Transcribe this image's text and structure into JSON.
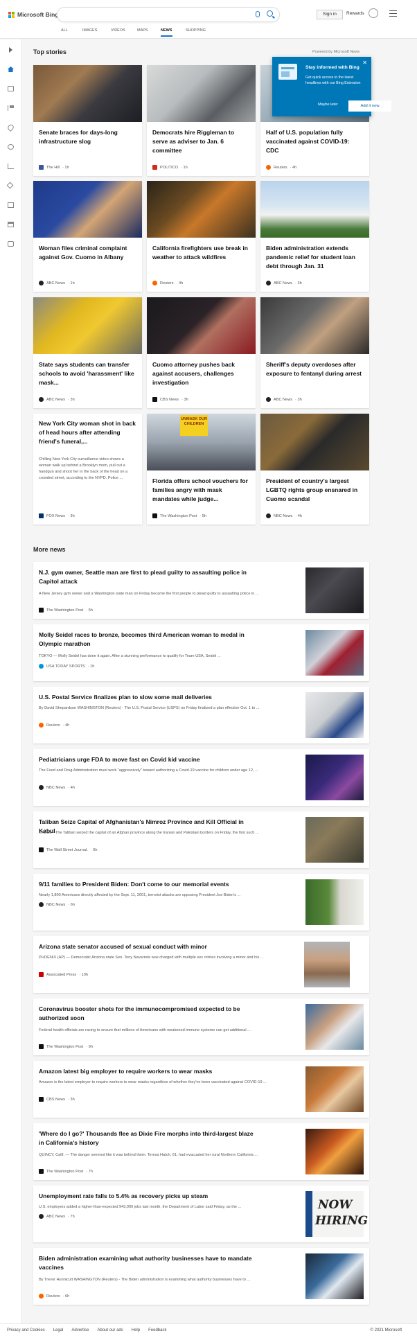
{
  "header": {
    "logo_text": "Microsoft Bing",
    "signin_label": "Sign in",
    "rewards_label": "Rewards",
    "tabs": [
      {
        "label": "ALL"
      },
      {
        "label": "IMAGES"
      },
      {
        "label": "VIDEOS"
      },
      {
        "label": "MAPS"
      },
      {
        "label": "NEWS"
      },
      {
        "label": "SHOPPING"
      }
    ]
  },
  "top_stories": {
    "title": "Top stories",
    "powered_by": "Powered by Microsoft News",
    "cards": [
      {
        "title": "Senate braces for days-long infrastructure slog",
        "source": "The Hill",
        "time": "· 1h"
      },
      {
        "title": "Democrats hire Riggleman to serve as adviser to Jan. 6 committee",
        "source": "POLITICO",
        "time": "· 1h"
      },
      {
        "title": "Half of U.S. population fully vaccinated against COVID-19: CDC",
        "source": "Reuters",
        "time": "· 4h"
      },
      {
        "title": "Woman files criminal complaint against Gov. Cuomo in Albany",
        "source": "ABC News",
        "time": "· 1h"
      },
      {
        "title": "California firefighters use break in weather to attack wildfires",
        "source": "Reuters",
        "time": "· 4h"
      },
      {
        "title": "Biden administration extends pandemic relief for student loan debt through Jan. 31",
        "source": "ABC News",
        "time": "· 3h"
      },
      {
        "title": "State says students can transfer schools to avoid 'harassment' like mask...",
        "source": "ABC News",
        "time": "· 3h"
      },
      {
        "title": "Cuomo attorney pushes back against accusers, challenges investigation",
        "source": "CBS News",
        "time": "· 3h"
      },
      {
        "title": "Sheriff's deputy overdoses after exposure to fentanyl during arrest",
        "source": "ABC News",
        "time": "· 3h"
      },
      {
        "title": "New York City woman shot in back of head hours after attending friend's funeral,...",
        "desc": "Chilling New York City surveillance video shows a woman walk up behind a Brooklyn mom, pull out a handgun and shoot her in the back of the head on a crowded street, according to the NYPD. Police ...",
        "source": "FOX News",
        "time": "· 3h"
      },
      {
        "title": "Florida offers school vouchers for families angry with mask mandates while judge...",
        "source": "The Washington Post",
        "time": "· 5h",
        "img_sign": "UNMASK OUR CHILDREN"
      },
      {
        "title": "President of country's largest LGBTQ rights group ensnared in Cuomo scandal",
        "source": "NBC News",
        "time": "· 4h"
      }
    ]
  },
  "popup": {
    "title": "Stay informed with Bing",
    "body": "Get quick access to the latest headlines with our Bing Extension",
    "later_label": "Maybe later",
    "add_label": "Add it now",
    "close": "✕"
  },
  "more_news": {
    "title": "More news",
    "rows": [
      {
        "title": "N.J. gym owner, Seattle man are first to plead guilty to assaulting police in Capitol attack",
        "desc": "A New Jersey gym owner and a Washington state man on Friday became the first people to plead guilty to assaulting police in ...",
        "source": "The Washington Post",
        "time": "· 5h"
      },
      {
        "title": "Molly Seidel races to bronze, becomes third American woman to medal in Olympic marathon",
        "desc": "TOKYO — Molly Seidel has done it again. After a stunning performance to qualify for Team USA, Seidel ...",
        "source": "USA TODAY SPORTS",
        "time": "· 1h"
      },
      {
        "title": "U.S. Postal Service finalizes plan to slow some mail deliveries",
        "desc": "By David Shepardson WASHINGTON (Reuters) - The U.S. Postal Service (USPS) on Friday finalized a plan effective Oct. 1 to ...",
        "source": "Reuters",
        "time": "· 4h"
      },
      {
        "title": "Pediatricians urge FDA to move fast on Covid kid vaccine",
        "desc": "The Food and Drug Administration must work \"aggressively\" toward authorizing a Covid-19 vaccine for children under age 12, ...",
        "source": "NBC News",
        "time": "· 4h"
      },
      {
        "title": "Taliban Seize Capital of Afghanistan's Nimroz Province and Kill Official in Kabul",
        "desc": "KABUL—The Taliban seized the capital of an Afghan province along the Iranian and Pakistani borders on Friday, the first such ...",
        "source": "The Wall Street Journal.",
        "time": "· 6h"
      },
      {
        "title": "9/11 families to President Biden: Don't come to our memorial events",
        "desc": "Nearly 1,800 Americans directly affected by the Sept. 11, 2001, terrorist attacks are opposing President Joe Biden's ...",
        "source": "NBC News",
        "time": "· 6h"
      },
      {
        "title": "Arizona state senator accused of sexual conduct with minor",
        "desc": "PHOENIX (AP) — Democratic Arizona state Sen. Tony Navarrete was charged with multiple sex crimes involving a minor and his ...",
        "source": "Associated Press",
        "time": "· 10h"
      },
      {
        "title": "Coronavirus booster shots for the immunocompromised expected to be authorized soon",
        "desc": "Federal health officials are racing to ensure that millions of Americans with weakened immune systems can get additional ...",
        "source": "The Washington Post",
        "time": "· 9h"
      },
      {
        "title": "Amazon latest big employer to require workers to wear masks",
        "desc": "Amazon is the latest employer to require workers to wear masks regardless of whether they've been vaccinated against COVID-19 ...",
        "source": "CBS News",
        "time": "· 3h"
      },
      {
        "title": "'Where do I go?' Thousands flee as Dixie Fire morphs into third-largest blaze in California's history",
        "desc": "QUINCY, Calif. — The danger seemed like it was behind them. Teresa Hatch, 61, had evacuated her rural Northern California ...",
        "source": "The Washington Post",
        "time": "· 7h"
      },
      {
        "title": "Unemployment rate falls to 5.4% as recovery picks up steam",
        "desc": "U.S. employers added a higher-than-expected 943,000 jobs last month, the Department of Labor said Friday, as the ...",
        "source": "ABC News",
        "time": "· 7h",
        "img_text_1": "NOW",
        "img_text_2": "HIRING"
      },
      {
        "title": "Biden administration examining what authority businesses have to mandate vaccines",
        "desc": "By Trevor Hunnicutt WASHINGTON (Reuters) - The Biden administration is examining what authority businesses have to ...",
        "source": "Reuters",
        "time": "· 6h"
      }
    ]
  },
  "footer": {
    "links": [
      "Privacy and Cookies",
      "Legal",
      "Advertise",
      "About our ads",
      "Help",
      "Feedback"
    ],
    "copyright": "© 2021 Microsoft"
  },
  "colors": {
    "accent": "#1a73c8",
    "popup_bg": "#0078b8"
  }
}
